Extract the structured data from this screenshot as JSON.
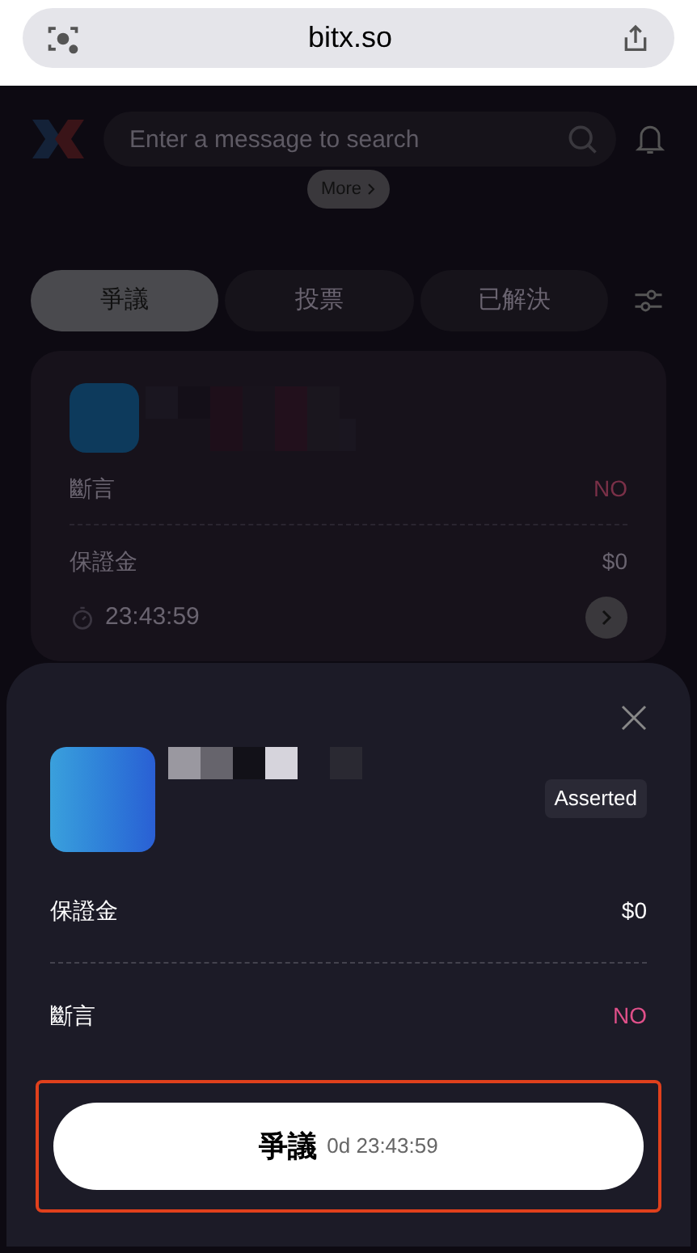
{
  "browser": {
    "url": "bitx.so"
  },
  "header": {
    "search": {
      "placeholder": "Enter a message to search"
    },
    "more": "More"
  },
  "tabs": [
    {
      "label": "爭議",
      "selected": true
    },
    {
      "label": "投票",
      "selected": false
    },
    {
      "label": "已解決",
      "selected": false
    }
  ],
  "card": {
    "rows": [
      {
        "label": "斷言",
        "value": "NO",
        "kind": "outcome"
      },
      {
        "label": "保證金",
        "value": "$0",
        "kind": "plain"
      }
    ],
    "timer": "23:43:59"
  },
  "sheet": {
    "status": "Asserted",
    "rows": [
      {
        "label": "保證金",
        "value": "$0",
        "kind": "plain"
      },
      {
        "label": "斷言",
        "value": "NO",
        "kind": "outcome"
      }
    ],
    "button": {
      "label": "爭議",
      "timer": "0d 23:43:59"
    },
    "highlighted": true
  }
}
